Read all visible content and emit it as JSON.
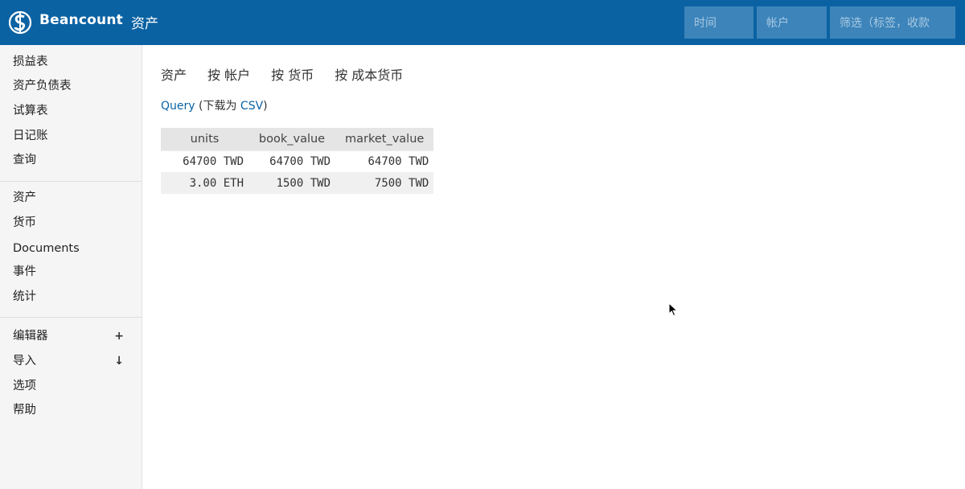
{
  "header": {
    "brand": "Beancount",
    "separator": "›",
    "breadcrumb": "资产",
    "time_placeholder": "时间",
    "account_placeholder": "帐户",
    "filter_placeholder": "筛选（标签，收款"
  },
  "sidebar": {
    "group1": [
      "损益表",
      "资产负债表",
      "试算表",
      "日记账",
      "查询"
    ],
    "group2": [
      "资产",
      "货币",
      "Documents",
      "事件",
      "统计"
    ],
    "group3": [
      {
        "label": "编辑器",
        "action": "+"
      },
      {
        "label": "导入",
        "action": "↓"
      },
      {
        "label": "选项",
        "action": ""
      },
      {
        "label": "帮助",
        "action": ""
      }
    ]
  },
  "main": {
    "tabs": [
      "资产",
      "按 帐户",
      "按 货币",
      "按 成本货币"
    ],
    "query_link": "Query",
    "query_paren_open": "(下载为 ",
    "csv_link": "CSV",
    "query_paren_close": ")",
    "table": {
      "headers": [
        "units",
        "book_value",
        "market_value"
      ],
      "rows": [
        [
          "64700 TWD",
          "64700 TWD",
          "64700 TWD"
        ],
        [
          "3.00 ETH",
          "1500 TWD",
          "7500 TWD"
        ]
      ]
    }
  },
  "colors": {
    "header_bg": "#0b62a3",
    "link": "#0b62a3",
    "sidebar_bg": "#f5f5f5"
  }
}
